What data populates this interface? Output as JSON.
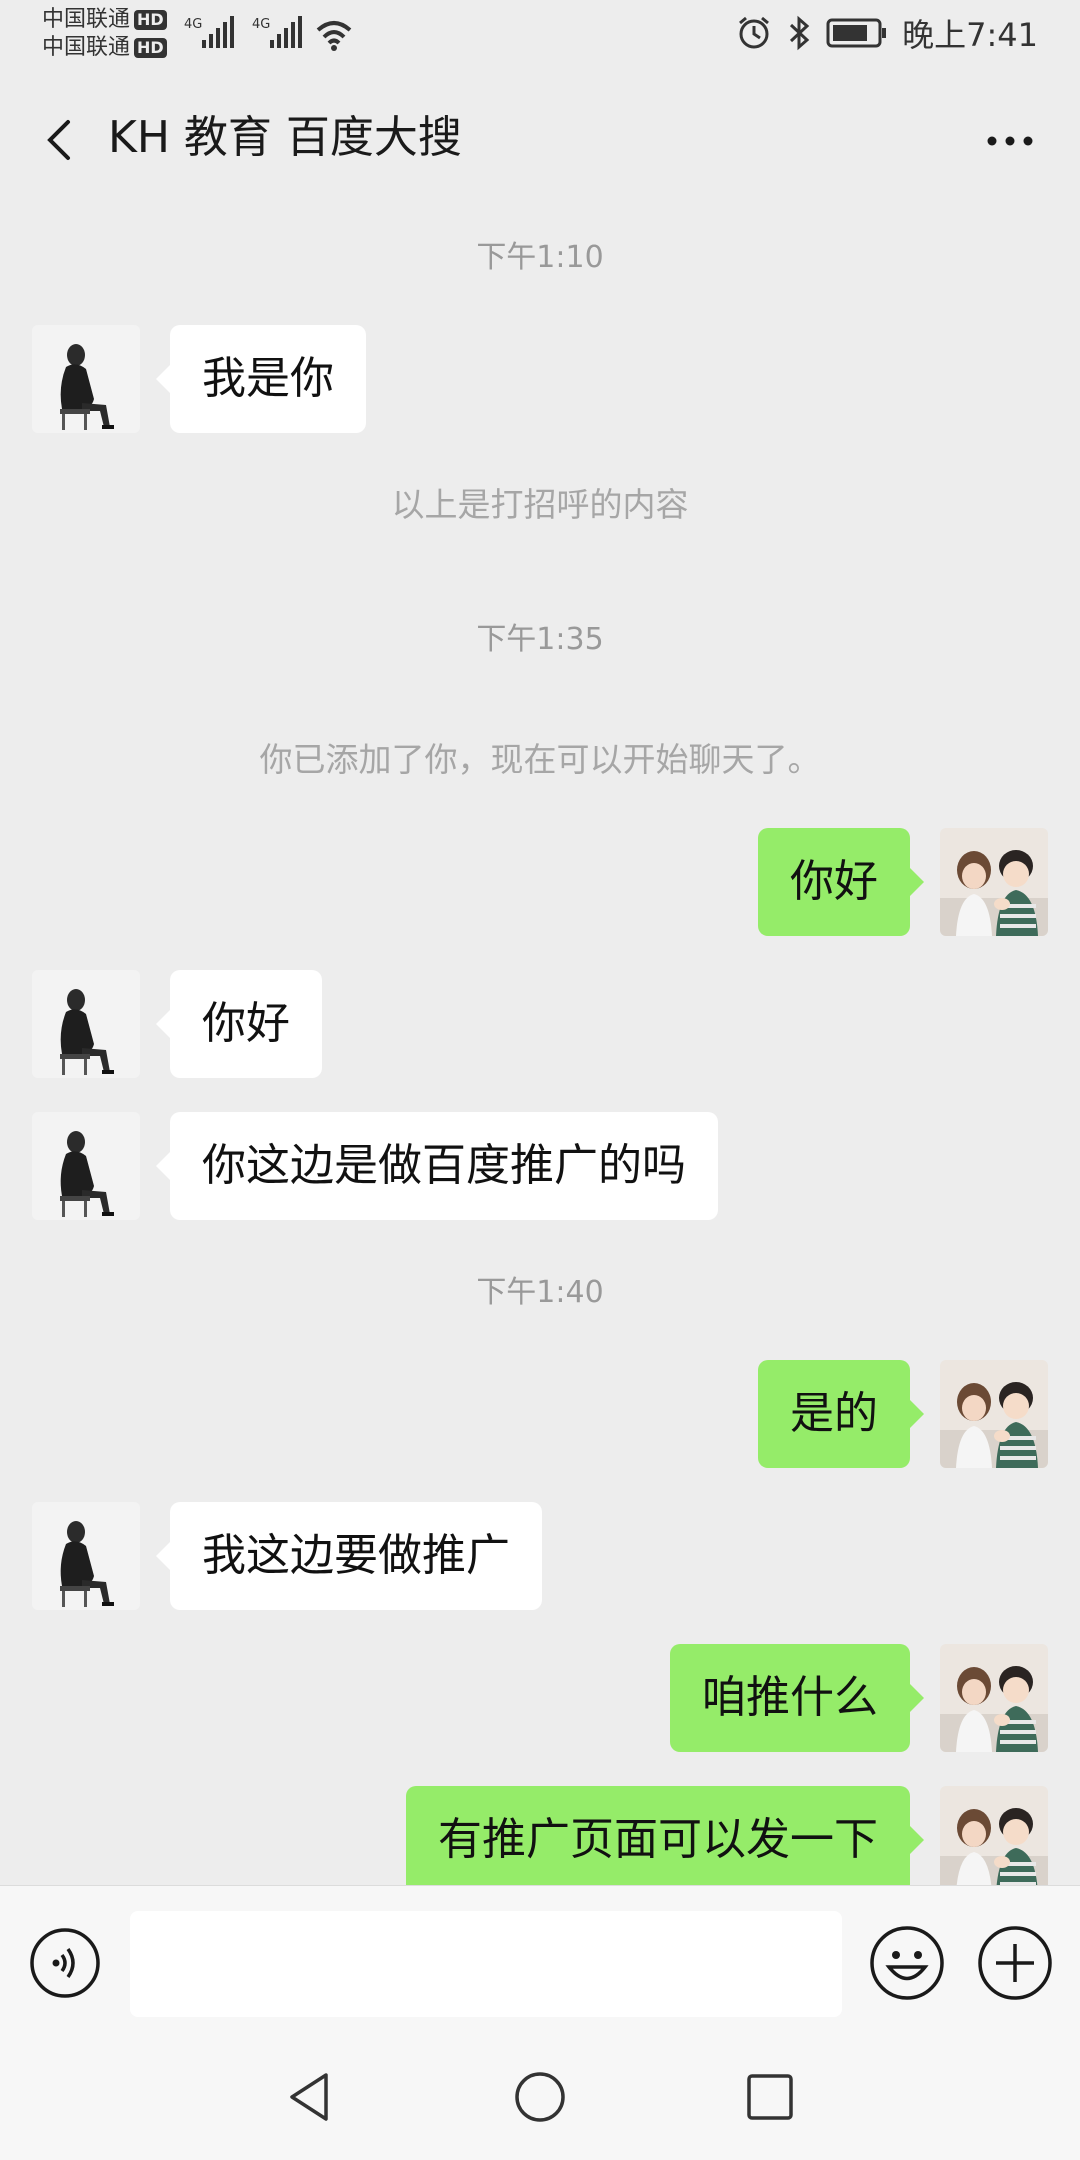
{
  "status": {
    "carrier1": "中国联通",
    "carrier2": "中国联通",
    "hd": "HD",
    "network": "4G",
    "time": "晚上7:41"
  },
  "header": {
    "title": "KH 教育 百度大搜"
  },
  "messages": {
    "t1": "下午1:10",
    "m1": "我是你",
    "note1": "以上是打招呼的内容",
    "t2": "下午1:35",
    "note2": "你已添加了你，现在可以开始聊天了。",
    "m2": "你好",
    "m3": "你好",
    "m4": "你这边是做百度推广的吗",
    "t3": "下午1:40",
    "m5": "是的",
    "m6": "我这边要做推广",
    "m7": "咱推什么",
    "m8": "有推广页面可以发一下"
  },
  "input": {
    "value": "",
    "placeholder": ""
  },
  "colors": {
    "background": "#ededed",
    "outgoing_bubble": "#95ec69",
    "incoming_bubble": "#ffffff",
    "system_text": "#a6a6a6"
  },
  "icons": [
    "back-arrow-icon",
    "more-icon",
    "alarm-icon",
    "bluetooth-icon",
    "battery-icon",
    "wifi-icon",
    "signal-icon",
    "voice-icon",
    "emoji-icon",
    "plus-icon",
    "nav-back-icon",
    "nav-home-icon",
    "nav-recent-icon"
  ]
}
